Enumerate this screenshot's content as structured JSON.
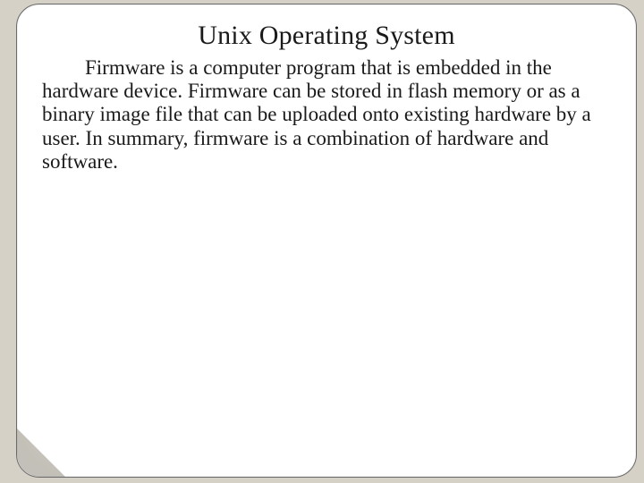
{
  "slide": {
    "title": "Unix Operating System",
    "body": "Firmware is a computer program that is embedded in the hardware device. Firmware can be stored in flash memory or as a binary image file that can be uploaded onto existing hardware by a user. In summary, firmware is a combination of hardware and software."
  }
}
